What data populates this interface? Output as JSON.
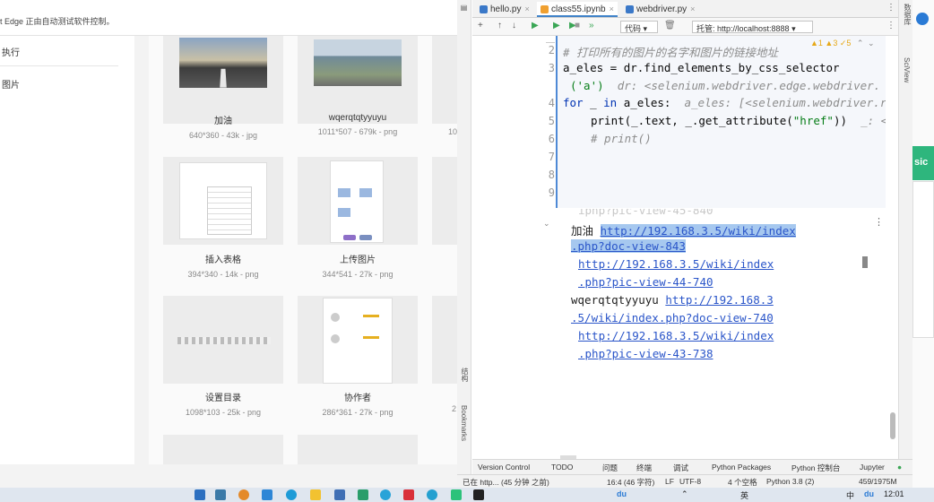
{
  "browser": {
    "infobar_text": "t Edge 正由自动测试软件控制。",
    "left_items": [
      "执行",
      "图片"
    ],
    "images": [
      {
        "name": "加油",
        "meta": "640*360 - 43k - jpg"
      },
      {
        "name": "wqerqtqtyyuyu",
        "meta": "1011*507 - 679k - png"
      },
      {
        "name": "插入表格",
        "meta": "394*340 - 14k - png"
      },
      {
        "name": "上传图片",
        "meta": "344*541 - 27k - png"
      },
      {
        "name": "设置目录",
        "meta": "1098*103 - 25k - png"
      },
      {
        "name": "协作者",
        "meta": "286*361 - 27k - png"
      }
    ],
    "partial_meta": [
      "10",
      "2"
    ]
  },
  "ide": {
    "tabs": [
      {
        "label": "hello.py",
        "color": "#3a78c8"
      },
      {
        "label": "class55.ipynb",
        "color": "#f0a030"
      },
      {
        "label": "webdriver.py",
        "color": "#3a78c8"
      }
    ],
    "toolbar": {
      "cell_type": "代码",
      "server": "托管: http://localhost:8888"
    },
    "inspections": "▲1 ▲3 ✓5",
    "line_numbers": [
      "2",
      "3",
      "4",
      "5",
      "6",
      "7",
      "8",
      "9"
    ],
    "code": {
      "comment1": "# 打印所有的图片的名字和图片的链接地址",
      "line3a": "a_eles = dr.find_elements_by_css_selector",
      "line3b": "('a')",
      "line3b_hint": "dr: <selenium.webdriver.edge.webdriver.",
      "line4_for": "for",
      "line4_rest": " _ ",
      "line4_in": "in",
      "line4_tail": " a_eles:",
      "line4_hint": "a_eles: [<selenium.webdriver.r",
      "line5a": "print(_.text, _.get_attribute(",
      "line5_str": "\"href\"",
      "line5b": "))",
      "line5_hint": "_: <",
      "line6": "# print()"
    },
    "output": {
      "partial_top": "iphp?pic-view-45-840",
      "row1_label": "加油 ",
      "row1_link_a": "http://192.168.3.5/wiki/index",
      "row1_link_b": ".php?doc-view-843",
      "row2_link_a": "http://192.168.3.5/wiki/index",
      "row2_link_b": ".php?pic-view-44-740",
      "row3_label": "wqerqtqtyyuyu ",
      "row3_link_a": "http://192.168.3",
      "row3_link_b": ".5/wiki/index.php?doc-view-740",
      "row4_link_a": "http://192.168.3.5/wiki/index",
      "row4_link_b": ".php?pic-view-43-738"
    },
    "left_strip": {
      "structure": "结构",
      "bookmarks": "Bookmarks"
    },
    "right_strip": {
      "db": "数据库",
      "sciview": "SciView"
    },
    "bottom_tools": [
      "Version Control",
      "TODO",
      "问题",
      "终端",
      "调试",
      "Python Packages",
      "Python 控制台",
      "Jupyter"
    ],
    "status": {
      "left": "已在 http... (45 分钟 之前)",
      "position": "16:4 (46 字符)",
      "line_sep": "LF",
      "encoding": "UTF-8",
      "indent": "4 个空格",
      "interpreter": "Python 3.8 (2)",
      "memory": "459/1975M"
    }
  },
  "right_window": {
    "green_text": "sic"
  },
  "taskbar": {
    "ime": "英",
    "time": "12:01",
    "input_label": "中",
    "du": "du"
  }
}
